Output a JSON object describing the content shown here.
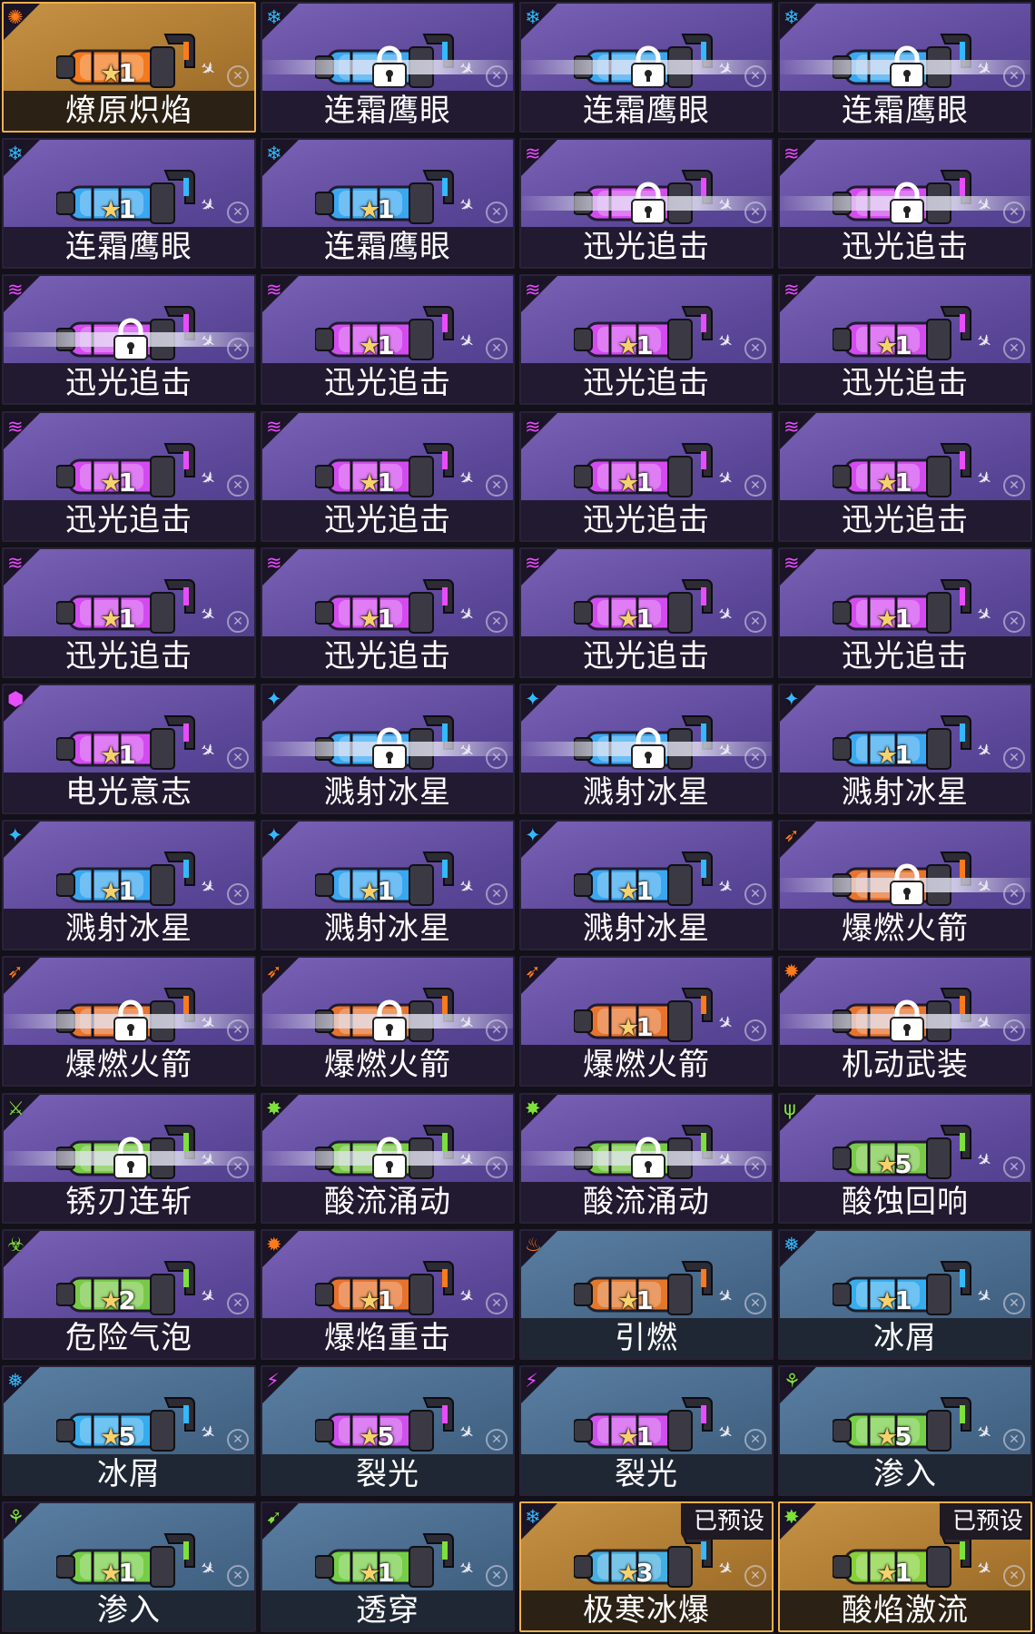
{
  "colors": {
    "card_purple": "#6a54a8",
    "card_blue": "#4d6e90",
    "card_gold": "#b98337",
    "name_bar": "#221a30",
    "star": "#f6d16c"
  },
  "cards": [
    {
      "name": "燎原炽焰",
      "bg": "gold",
      "element": "#ff7a1a",
      "icon": "flame-icon",
      "glyph": "✺",
      "locked": false,
      "stars": "1",
      "preset": ""
    },
    {
      "name": "连霜鹰眼",
      "bg": "purple",
      "element": "#34b8ff",
      "icon": "frost-reticle-icon",
      "glyph": "❄",
      "locked": true,
      "stars": "",
      "preset": ""
    },
    {
      "name": "连霜鹰眼",
      "bg": "purple",
      "element": "#34b8ff",
      "icon": "frost-reticle-icon",
      "glyph": "❄",
      "locked": true,
      "stars": "",
      "preset": ""
    },
    {
      "name": "连霜鹰眼",
      "bg": "purple",
      "element": "#34b8ff",
      "icon": "frost-reticle-icon",
      "glyph": "❄",
      "locked": true,
      "stars": "",
      "preset": ""
    },
    {
      "name": "连霜鹰眼",
      "bg": "purple",
      "element": "#34b8ff",
      "icon": "frost-reticle-icon",
      "glyph": "❄",
      "locked": false,
      "stars": "1",
      "preset": ""
    },
    {
      "name": "连霜鹰眼",
      "bg": "purple",
      "element": "#34b8ff",
      "icon": "frost-reticle-icon",
      "glyph": "❄",
      "locked": false,
      "stars": "1",
      "preset": ""
    },
    {
      "name": "迅光追击",
      "bg": "purple",
      "element": "#e84cff",
      "icon": "lightning-wave-icon",
      "glyph": "≋",
      "locked": true,
      "stars": "",
      "preset": ""
    },
    {
      "name": "迅光追击",
      "bg": "purple",
      "element": "#e84cff",
      "icon": "lightning-wave-icon",
      "glyph": "≋",
      "locked": true,
      "stars": "",
      "preset": ""
    },
    {
      "name": "迅光追击",
      "bg": "purple",
      "element": "#e84cff",
      "icon": "lightning-wave-icon",
      "glyph": "≋",
      "locked": true,
      "stars": "",
      "preset": ""
    },
    {
      "name": "迅光追击",
      "bg": "purple",
      "element": "#e84cff",
      "icon": "lightning-wave-icon",
      "glyph": "≋",
      "locked": false,
      "stars": "1",
      "preset": ""
    },
    {
      "name": "迅光追击",
      "bg": "purple",
      "element": "#e84cff",
      "icon": "lightning-wave-icon",
      "glyph": "≋",
      "locked": false,
      "stars": "1",
      "preset": ""
    },
    {
      "name": "迅光追击",
      "bg": "purple",
      "element": "#e84cff",
      "icon": "lightning-wave-icon",
      "glyph": "≋",
      "locked": false,
      "stars": "1",
      "preset": ""
    },
    {
      "name": "迅光追击",
      "bg": "purple",
      "element": "#e84cff",
      "icon": "lightning-wave-icon",
      "glyph": "≋",
      "locked": false,
      "stars": "1",
      "preset": ""
    },
    {
      "name": "迅光追击",
      "bg": "purple",
      "element": "#e84cff",
      "icon": "lightning-wave-icon",
      "glyph": "≋",
      "locked": false,
      "stars": "1",
      "preset": ""
    },
    {
      "name": "迅光追击",
      "bg": "purple",
      "element": "#e84cff",
      "icon": "lightning-wave-icon",
      "glyph": "≋",
      "locked": false,
      "stars": "1",
      "preset": ""
    },
    {
      "name": "迅光追击",
      "bg": "purple",
      "element": "#e84cff",
      "icon": "lightning-wave-icon",
      "glyph": "≋",
      "locked": false,
      "stars": "1",
      "preset": ""
    },
    {
      "name": "迅光追击",
      "bg": "purple",
      "element": "#e84cff",
      "icon": "lightning-wave-icon",
      "glyph": "≋",
      "locked": false,
      "stars": "1",
      "preset": ""
    },
    {
      "name": "迅光追击",
      "bg": "purple",
      "element": "#e84cff",
      "icon": "lightning-wave-icon",
      "glyph": "≋",
      "locked": false,
      "stars": "1",
      "preset": ""
    },
    {
      "name": "迅光追击",
      "bg": "purple",
      "element": "#e84cff",
      "icon": "lightning-wave-icon",
      "glyph": "≋",
      "locked": false,
      "stars": "1",
      "preset": ""
    },
    {
      "name": "迅光追击",
      "bg": "purple",
      "element": "#e84cff",
      "icon": "lightning-wave-icon",
      "glyph": "≋",
      "locked": false,
      "stars": "1",
      "preset": ""
    },
    {
      "name": "电光意志",
      "bg": "purple",
      "element": "#e84cff",
      "icon": "electric-orb-icon",
      "glyph": "⬢",
      "locked": false,
      "stars": "1",
      "preset": ""
    },
    {
      "name": "溅射冰星",
      "bg": "purple",
      "element": "#34b8ff",
      "icon": "ice-splash-icon",
      "glyph": "✦",
      "locked": true,
      "stars": "",
      "preset": ""
    },
    {
      "name": "溅射冰星",
      "bg": "purple",
      "element": "#34b8ff",
      "icon": "ice-splash-icon",
      "glyph": "✦",
      "locked": true,
      "stars": "",
      "preset": ""
    },
    {
      "name": "溅射冰星",
      "bg": "purple",
      "element": "#34b8ff",
      "icon": "ice-splash-icon",
      "glyph": "✦",
      "locked": false,
      "stars": "1",
      "preset": ""
    },
    {
      "name": "溅射冰星",
      "bg": "purple",
      "element": "#34b8ff",
      "icon": "ice-splash-icon",
      "glyph": "✦",
      "locked": false,
      "stars": "1",
      "preset": ""
    },
    {
      "name": "溅射冰星",
      "bg": "purple",
      "element": "#34b8ff",
      "icon": "ice-splash-icon",
      "glyph": "✦",
      "locked": false,
      "stars": "1",
      "preset": ""
    },
    {
      "name": "溅射冰星",
      "bg": "purple",
      "element": "#34b8ff",
      "icon": "ice-splash-icon",
      "glyph": "✦",
      "locked": false,
      "stars": "1",
      "preset": ""
    },
    {
      "name": "爆燃火箭",
      "bg": "purple",
      "element": "#ff7a1a",
      "icon": "rocket-icon",
      "glyph": "➶",
      "locked": true,
      "stars": "",
      "preset": ""
    },
    {
      "name": "爆燃火箭",
      "bg": "purple",
      "element": "#ff7a1a",
      "icon": "rocket-icon",
      "glyph": "➶",
      "locked": true,
      "stars": "",
      "preset": ""
    },
    {
      "name": "爆燃火箭",
      "bg": "purple",
      "element": "#ff7a1a",
      "icon": "rocket-icon",
      "glyph": "➶",
      "locked": true,
      "stars": "",
      "preset": ""
    },
    {
      "name": "爆燃火箭",
      "bg": "purple",
      "element": "#ff7a1a",
      "icon": "rocket-icon",
      "glyph": "➶",
      "locked": false,
      "stars": "1",
      "preset": ""
    },
    {
      "name": "机动武装",
      "bg": "purple",
      "element": "#ff7a1a",
      "icon": "burst-icon",
      "glyph": "✹",
      "locked": true,
      "stars": "",
      "preset": ""
    },
    {
      "name": "锈刃连斩",
      "bg": "purple",
      "element": "#7ee03a",
      "icon": "blade-icon",
      "glyph": "⚔",
      "locked": true,
      "stars": "",
      "preset": ""
    },
    {
      "name": "酸流涌动",
      "bg": "purple",
      "element": "#7ee03a",
      "icon": "acid-splash-icon",
      "glyph": "✸",
      "locked": true,
      "stars": "",
      "preset": ""
    },
    {
      "name": "酸流涌动",
      "bg": "purple",
      "element": "#7ee03a",
      "icon": "acid-splash-icon",
      "glyph": "✸",
      "locked": true,
      "stars": "",
      "preset": ""
    },
    {
      "name": "酸蚀回响",
      "bg": "purple",
      "element": "#7ee03a",
      "icon": "acid-echo-icon",
      "glyph": "ψ",
      "locked": false,
      "stars": "5",
      "preset": ""
    },
    {
      "name": "危险气泡",
      "bg": "purple",
      "element": "#7ee03a",
      "icon": "bubble-icon",
      "glyph": "☣",
      "locked": false,
      "stars": "2",
      "preset": ""
    },
    {
      "name": "爆焰重击",
      "bg": "purple",
      "element": "#ff7a1a",
      "icon": "explosion-icon",
      "glyph": "✹",
      "locked": false,
      "stars": "1",
      "preset": ""
    },
    {
      "name": "引燃",
      "bg": "blue",
      "element": "#ff7a1a",
      "icon": "flame-icon",
      "glyph": "♨",
      "locked": false,
      "stars": "1",
      "preset": ""
    },
    {
      "name": "冰屑",
      "bg": "blue",
      "element": "#34b8ff",
      "icon": "ice-shard-icon",
      "glyph": "❅",
      "locked": false,
      "stars": "1",
      "preset": ""
    },
    {
      "name": "冰屑",
      "bg": "blue",
      "element": "#34b8ff",
      "icon": "ice-shard-icon",
      "glyph": "❅",
      "locked": false,
      "stars": "5",
      "preset": ""
    },
    {
      "name": "裂光",
      "bg": "blue",
      "element": "#e84cff",
      "icon": "split-light-icon",
      "glyph": "⚡",
      "locked": false,
      "stars": "5",
      "preset": ""
    },
    {
      "name": "裂光",
      "bg": "blue",
      "element": "#e84cff",
      "icon": "split-light-icon",
      "glyph": "⚡",
      "locked": false,
      "stars": "1",
      "preset": ""
    },
    {
      "name": "渗入",
      "bg": "blue",
      "element": "#7ee03a",
      "icon": "seep-icon",
      "glyph": "⚘",
      "locked": false,
      "stars": "5",
      "preset": ""
    },
    {
      "name": "渗入",
      "bg": "blue",
      "element": "#7ee03a",
      "icon": "seep-icon",
      "glyph": "⚘",
      "locked": false,
      "stars": "1",
      "preset": ""
    },
    {
      "name": "透穿",
      "bg": "blue",
      "element": "#7ee03a",
      "icon": "pierce-icon",
      "glyph": "➹",
      "locked": false,
      "stars": "1",
      "preset": ""
    },
    {
      "name": "极寒冰爆",
      "bg": "gold",
      "element": "#34b8ff",
      "icon": "ice-burst-icon",
      "glyph": "❄",
      "locked": false,
      "stars": "3",
      "preset": "已预设"
    },
    {
      "name": "酸焰激流",
      "bg": "gold",
      "element": "#7ee03a",
      "icon": "acid-flame-icon",
      "glyph": "✸",
      "locked": false,
      "stars": "1",
      "preset": "已预设"
    }
  ]
}
